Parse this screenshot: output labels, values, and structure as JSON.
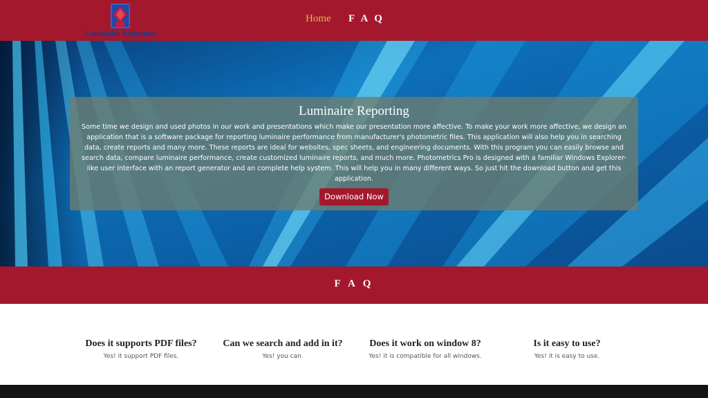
{
  "nav": {
    "logo_text": "Luminaire Reporting",
    "home_label": "Home",
    "faq_label": "F A Q"
  },
  "hero": {
    "title": "Luminaire Reporting",
    "body": "Some time we design and used photos in our work and presentations which make our presentation more affective. To make your work more affective, we design an application that is a software package for reporting luminaire performance from manufacturer's photometric files. This application will also help you in searching data, create reports and many more. These reports are ideal for websites, spec sheets, and engineering documents. With this program you can easily browse and search data, compare luminaire performance, create customized luminaire reports, and much more. Photometrics Pro is designed with a familiar Windows Explorer-like user interface with an report generator and an complete help system. This will help you in many different ways. So just hit the download button and get this application.",
    "button_label": "Download Now"
  },
  "faq": {
    "title": "F A Q",
    "items": [
      {
        "question": "Does it supports PDF files?",
        "answer": "Yes! it support PDF files."
      },
      {
        "question": "Can we search and add in it?",
        "answer": "Yes! you can."
      },
      {
        "question": "Does it work on window 8?",
        "answer": "Yes! it is compatible for all windows."
      },
      {
        "question": "Is it easy to use?",
        "answer": "Yes! it is easy to use."
      }
    ]
  },
  "colors": {
    "brand_red": "#a3182d",
    "nav_active": "#e0b64a",
    "logo_blue": "#1d3b8c"
  }
}
